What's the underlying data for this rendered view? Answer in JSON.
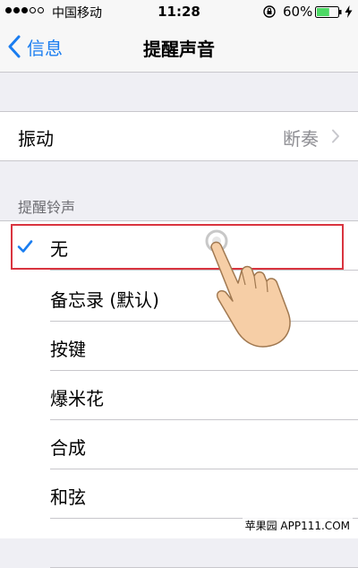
{
  "status_bar": {
    "carrier": "中国移动",
    "time": "11:28",
    "battery_percent": "60%",
    "battery_level": 0.6,
    "icons": [
      "signal-dots",
      "rotation-lock-icon",
      "battery-icon",
      "charging-bolt-icon"
    ]
  },
  "nav": {
    "back_label": "信息",
    "title": "提醒声音"
  },
  "vibration": {
    "label": "振动",
    "value": "断奏"
  },
  "section": {
    "header": "提醒铃声"
  },
  "tones": [
    {
      "label": "无",
      "selected": true
    },
    {
      "label": "备忘录 (默认)",
      "selected": false
    },
    {
      "label": "按键",
      "selected": false
    },
    {
      "label": "爆米花",
      "selected": false
    },
    {
      "label": "合成",
      "selected": false
    },
    {
      "label": "和弦",
      "selected": false
    },
    {
      "label": "",
      "selected": false
    }
  ],
  "watermark": {
    "text": "苹果园 APP111.COM"
  },
  "colors": {
    "accent": "#1a7df0",
    "highlight": "#d9343f",
    "background": "#efeff4"
  }
}
